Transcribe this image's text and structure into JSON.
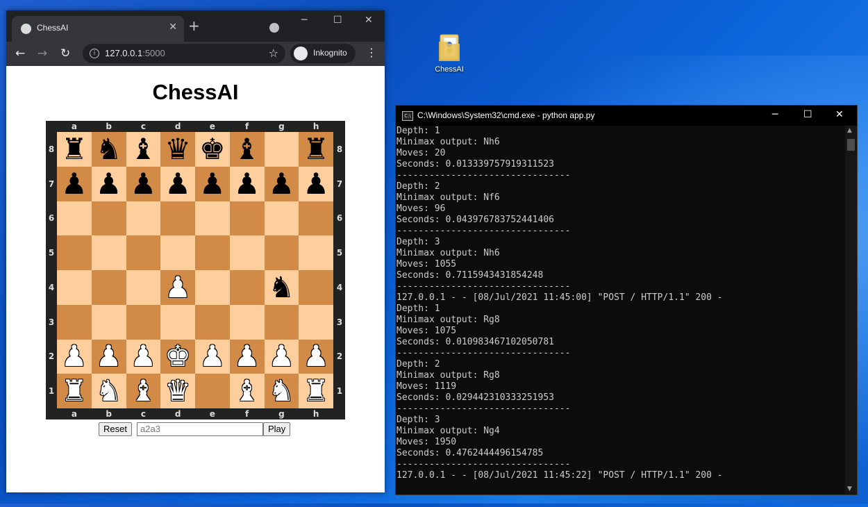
{
  "desktop": {
    "icon_label": "ChessAI"
  },
  "browser": {
    "tab_title": "ChessAI",
    "url_host": "127.0.0.1",
    "url_port": ":5000",
    "profile_label": "Inkognito",
    "icons": {
      "favicon": "globe-icon",
      "close": "close-icon",
      "new_tab": "plus-icon",
      "back": "back-arrow-icon",
      "forward": "forward-arrow-icon",
      "reload": "reload-icon",
      "info": "info-icon",
      "bookmark": "star-icon",
      "incognito": "incognito-icon",
      "menu": "kebab-icon"
    }
  },
  "page": {
    "title": "ChessAI",
    "files": [
      "a",
      "b",
      "c",
      "d",
      "e",
      "f",
      "g",
      "h"
    ],
    "ranks": [
      "8",
      "7",
      "6",
      "5",
      "4",
      "3",
      "2",
      "1"
    ],
    "board": [
      [
        "bR",
        "bN",
        "bB",
        "bQ",
        "bK",
        "bB",
        "",
        "bR"
      ],
      [
        "bP",
        "bP",
        "bP",
        "bP",
        "bP",
        "bP",
        "bP",
        "bP"
      ],
      [
        "",
        "",
        "",
        "",
        "",
        "",
        "",
        ""
      ],
      [
        "",
        "",
        "",
        "",
        "",
        "",
        "",
        ""
      ],
      [
        "",
        "",
        "",
        "wP",
        "",
        "",
        "bN",
        ""
      ],
      [
        "",
        "",
        "",
        "",
        "",
        "",
        "",
        ""
      ],
      [
        "wP",
        "wP",
        "wP",
        "wK",
        "wP",
        "wP",
        "wP",
        "wP"
      ],
      [
        "wR",
        "wN",
        "wB",
        "wQ",
        "",
        "wB",
        "wN",
        "wR"
      ]
    ],
    "colors": {
      "light_square": "#fecf9c",
      "dark_square": "#d18b47"
    },
    "reset_label": "Reset",
    "move_placeholder": "a2a3",
    "play_label": "Play"
  },
  "console": {
    "title": "C:\\Windows\\System32\\cmd.exe - python  app.py",
    "lines": [
      "Depth: 1",
      "Minimax output: Nh6",
      "Moves: 20",
      "Seconds: 0.013339757919311523",
      "--------------------------------",
      "Depth: 2",
      "Minimax output: Nf6",
      "Moves: 96",
      "Seconds: 0.043976783752441406",
      "--------------------------------",
      "Depth: 3",
      "Minimax output: Nh6",
      "Moves: 1055",
      "Seconds: 0.7115943431854248",
      "--------------------------------",
      "127.0.0.1 - - [08/Jul/2021 11:45:00] \"POST / HTTP/1.1\" 200 -",
      "Depth: 1",
      "Minimax output: Rg8",
      "Moves: 1075",
      "Seconds: 0.010983467102050781",
      "--------------------------------",
      "Depth: 2",
      "Minimax output: Rg8",
      "Moves: 1119",
      "Seconds: 0.029442310333251953",
      "--------------------------------",
      "Depth: 3",
      "Minimax output: Ng4",
      "Moves: 1950",
      "Seconds: 0.4762444496154785",
      "--------------------------------",
      "127.0.0.1 - - [08/Jul/2021 11:45:22] \"POST / HTTP/1.1\" 200 -"
    ]
  }
}
